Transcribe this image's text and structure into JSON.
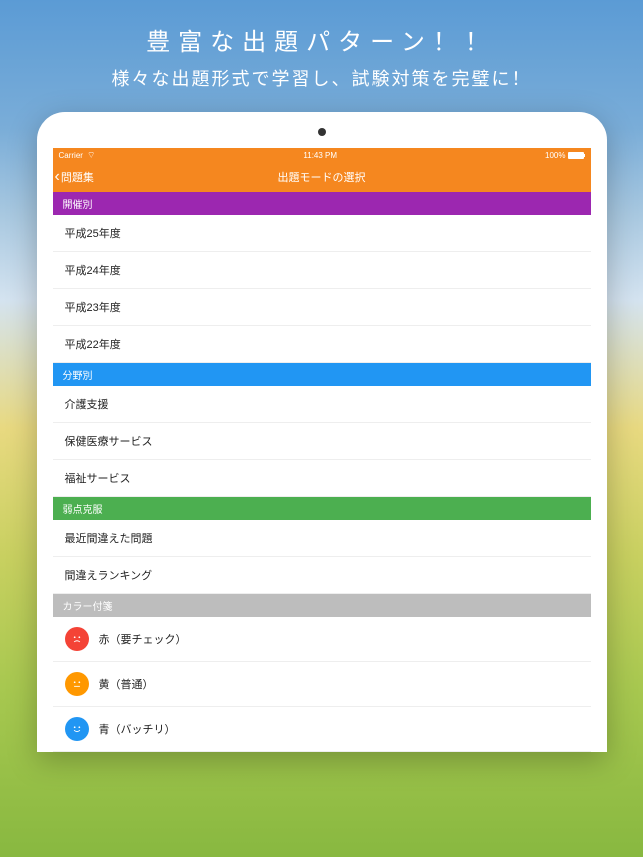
{
  "promo": {
    "title": "豊富な出題パターン！！",
    "subtitle": "様々な出題形式で学習し、試験対策を完璧に！"
  },
  "status_bar": {
    "carrier": "Carrier",
    "time": "11:43 PM",
    "battery": "100%"
  },
  "nav": {
    "back_label": "問題集",
    "title": "出題モードの選択"
  },
  "sections": {
    "by_year": {
      "header": "開催別",
      "items": [
        "平成25年度",
        "平成24年度",
        "平成23年度",
        "平成22年度"
      ]
    },
    "by_field": {
      "header": "分野別",
      "items": [
        "介護支援",
        "保健医療サービス",
        "福祉サービス"
      ]
    },
    "weakness": {
      "header": "弱点克服",
      "items": [
        "最近間違えた問題",
        "間違えランキング"
      ]
    },
    "color_tags": {
      "header": "カラー付箋",
      "items": [
        {
          "label": "赤（要チェック）",
          "color": "red",
          "face": "sad"
        },
        {
          "label": "黄（普通）",
          "color": "yellow",
          "face": "neutral"
        },
        {
          "label": "青（バッチリ）",
          "color": "blue",
          "face": "happy"
        }
      ]
    }
  }
}
